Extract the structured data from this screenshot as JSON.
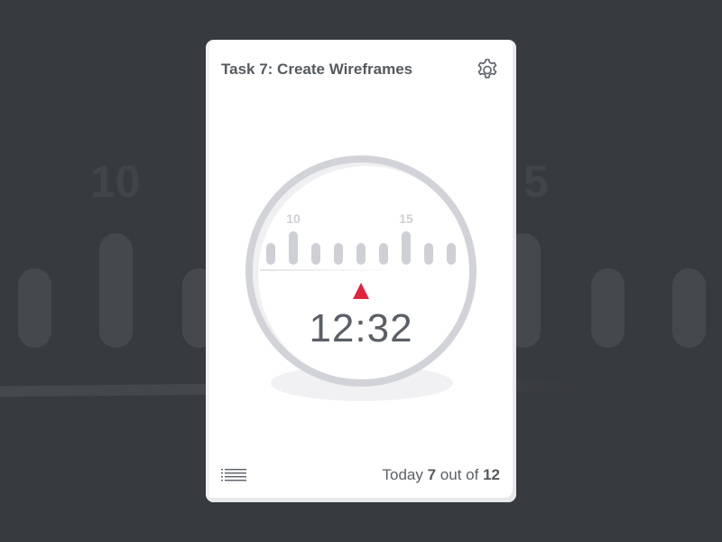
{
  "background": {
    "labels": [
      "10",
      "5"
    ]
  },
  "task": {
    "title": "Task 7: Create Wireframes"
  },
  "timer": {
    "time": "12:32",
    "scale_labels": [
      "10",
      "15"
    ]
  },
  "footer": {
    "prefix": "Today",
    "current": "7",
    "middle": "out of",
    "total": "12"
  },
  "icons": {
    "settings": "gear-icon",
    "list": "list-icon",
    "pointer": "triangle-up-icon"
  },
  "colors": {
    "background": "#373a3f",
    "card": "#ffffff",
    "accent": "#e2233d",
    "text": "#555a60",
    "ring": "#d2d3d8"
  }
}
